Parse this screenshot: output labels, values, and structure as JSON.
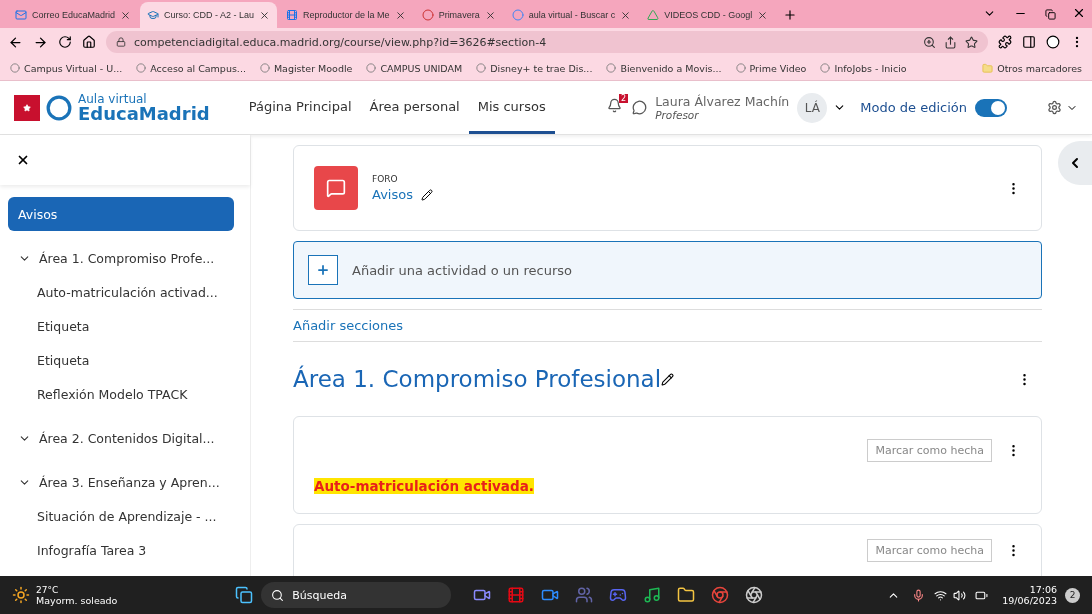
{
  "browser": {
    "tabs": [
      {
        "label": "Correo EducaMadrid",
        "selected": false
      },
      {
        "label": "Curso: CDD - A2 - Lau",
        "selected": true
      },
      {
        "label": "Reproductor de la Me",
        "selected": false
      },
      {
        "label": "Primavera",
        "selected": false
      },
      {
        "label": "aula virtual - Buscar c",
        "selected": false
      },
      {
        "label": "VIDEOS CDD - Googl",
        "selected": false
      }
    ],
    "url": "competenciadigital.educa.madrid.org/course/view.php?id=3626#section-4",
    "bookmarks": [
      "Campus Virtual - U...",
      "Acceso al Campus...",
      "Magister Moodle",
      "CAMPUS UNIDAM",
      "Disney+ te trae Dis...",
      "Bienvenido a Movis...",
      "Prime Video",
      "InfoJobs - Inicio"
    ],
    "other_bookmarks": "Otros marcadores"
  },
  "header": {
    "logo_top": "Aula virtual",
    "logo_bottom": "EducaMadrid",
    "nav": [
      {
        "label": "Página Principal",
        "selected": false
      },
      {
        "label": "Área personal",
        "selected": false
      },
      {
        "label": "Mis cursos",
        "selected": true
      }
    ],
    "notifications": "2",
    "user_name": "Laura Álvarez Machín",
    "user_role": "Profesor",
    "initials": "LÁ",
    "edit_mode_label": "Modo de edición",
    "edit_mode": true
  },
  "sidebar": {
    "items": [
      {
        "label": "Avisos",
        "selected": true
      },
      {
        "label": "Área 1. Compromiso Profe...",
        "selected": false,
        "expanded": true,
        "children": [
          {
            "label": "Auto-matriculación activad..."
          },
          {
            "label": "Etiqueta"
          },
          {
            "label": "Etiqueta"
          },
          {
            "label": "Reflexión Modelo TPACK"
          }
        ]
      },
      {
        "label": "Área 2. Contenidos Digital...",
        "selected": false,
        "expanded": true
      },
      {
        "label": "Área 3. Enseñanza y Apren...",
        "selected": false,
        "expanded": true,
        "children": [
          {
            "label": "Situación de Aprendizaje - ..."
          },
          {
            "label": "Infografía Tarea 3"
          }
        ]
      }
    ]
  },
  "content": {
    "forum": {
      "type": "FORO",
      "name": "Avisos"
    },
    "add_activity": "Añadir una actividad o un recurso",
    "add_sections": "Añadir secciones",
    "section_title": "Área 1. Compromiso Profesional",
    "activities": [
      {
        "button": "Marcar como hecha",
        "label": "Auto-matriculación activada."
      },
      {
        "button": "Marcar como hecha"
      }
    ]
  },
  "taskbar": {
    "temperature": "27°C",
    "weather": "Mayorm. soleado",
    "search": "Búsqueda",
    "time": "17:06",
    "date": "19/06/2023",
    "badge": "2"
  }
}
